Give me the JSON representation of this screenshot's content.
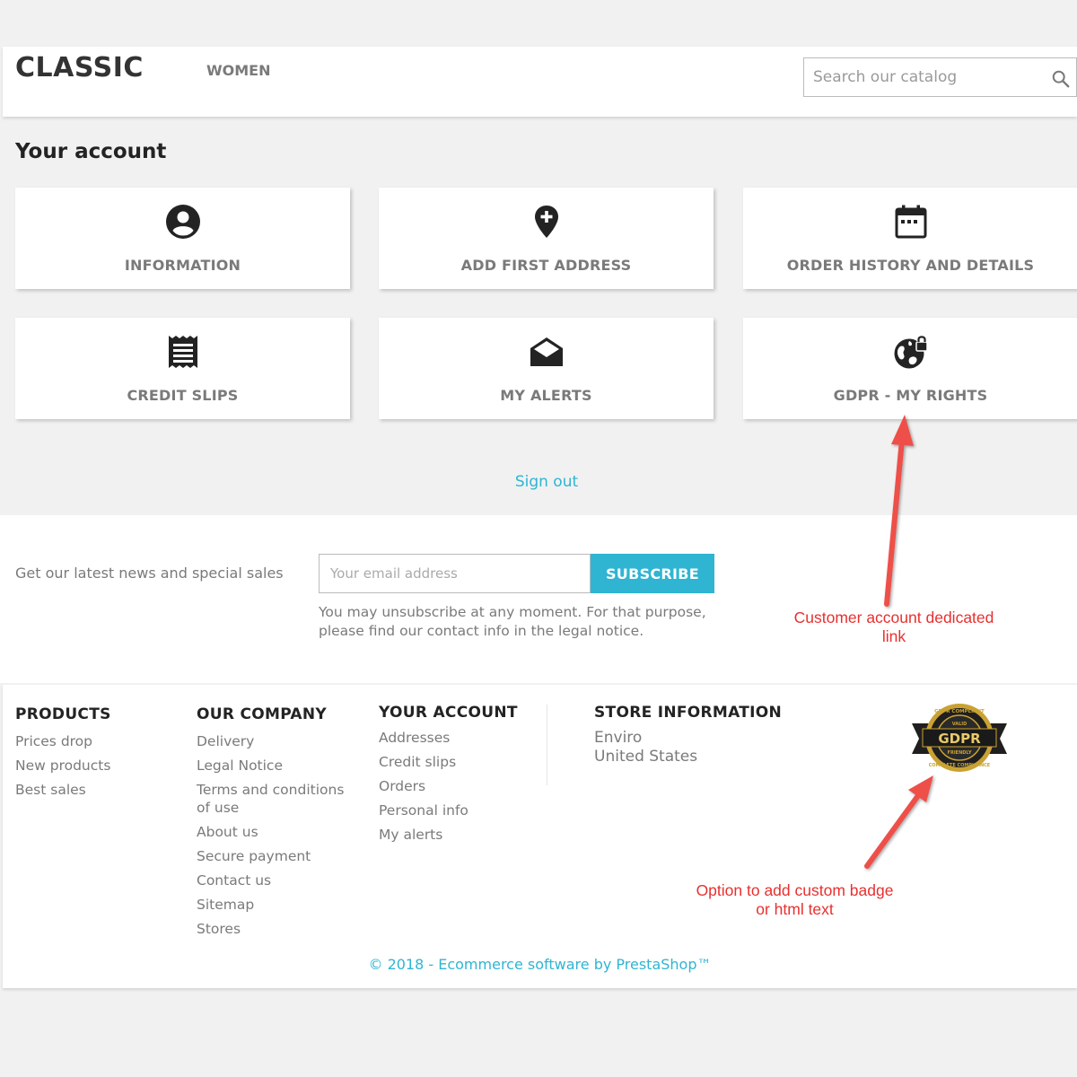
{
  "header": {
    "logo": "CLASSIC",
    "nav": {
      "women": "WOMEN"
    },
    "search_placeholder": "Search our catalog"
  },
  "account": {
    "title": "Your account",
    "cards": [
      {
        "label": "INFORMATION",
        "icon": "account-circle-icon"
      },
      {
        "label": "ADD FIRST ADDRESS",
        "icon": "add-location-icon"
      },
      {
        "label": "ORDER HISTORY AND DETAILS",
        "icon": "calendar-icon"
      },
      {
        "label": "CREDIT SLIPS",
        "icon": "receipt-icon"
      },
      {
        "label": "MY ALERTS",
        "icon": "open-envelope-icon"
      },
      {
        "label": "GDPR - MY RIGHTS",
        "icon": "globe-lock-icon"
      }
    ],
    "sign_out": "Sign out"
  },
  "newsletter": {
    "text": "Get our latest news and special sales",
    "email_placeholder": "Your email address",
    "subscribe": "SUBSCRIBE",
    "note": "You may unsubscribe at any moment. For that purpose, please find our contact info in the legal notice."
  },
  "annotations": {
    "customer_link": "Customer account dedicated link",
    "badge_option": "Option to add custom badge or html text"
  },
  "footer": {
    "products": {
      "title": "PRODUCTS",
      "links": [
        "Prices drop",
        "New products",
        "Best sales"
      ]
    },
    "company": {
      "title": "OUR COMPANY",
      "links": [
        "Delivery",
        "Legal Notice",
        "Terms and conditions of use",
        "About us",
        "Secure payment",
        "Contact us",
        "Sitemap",
        "Stores"
      ]
    },
    "your_account": {
      "title": "YOUR ACCOUNT",
      "links": [
        "Addresses",
        "Credit slips",
        "Orders",
        "Personal info",
        "My alerts"
      ]
    },
    "store": {
      "title": "STORE INFORMATION",
      "lines": [
        "Enviro",
        "United States"
      ]
    },
    "badge": {
      "icon": "gdpr-compliance-badge",
      "text_top": "GDPR COMPLIANT",
      "text_main": "GDPR",
      "text_sub": "FRIENDLY",
      "text_bottom": "COMPLETE COMPLIANCE",
      "text_valid": "VALID"
    },
    "copyright": "© 2018 - Ecommerce software by PrestaShop™"
  },
  "colors": {
    "accent": "#2fb5d2",
    "annotation": "#e8302f",
    "background": "#f1f1f1",
    "muted_text": "#7a7a7a"
  }
}
